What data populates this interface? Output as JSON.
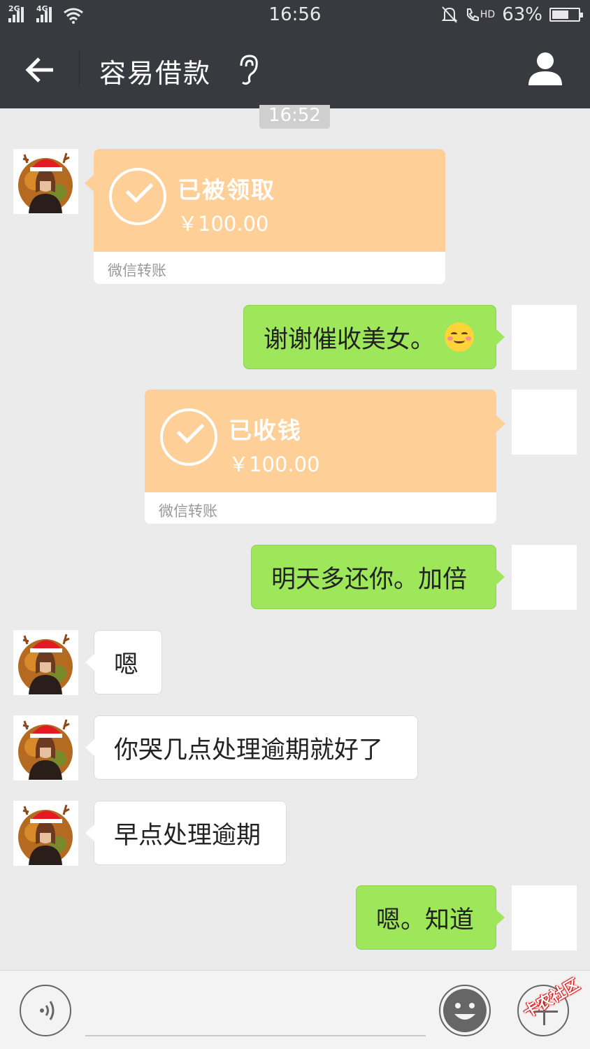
{
  "status_bar": {
    "network_1": "2G",
    "network_2": "4G",
    "time": "16:56",
    "hd_label": "HD",
    "battery_percent": "63%",
    "battery_level": 0.63
  },
  "header": {
    "title": "容易借款"
  },
  "chat": {
    "timestamp": "16:52",
    "transfer_received": {
      "status": "已被领取",
      "amount": "￥100.00",
      "footer": "微信转账"
    },
    "msg_thanks": "谢谢催收美女。",
    "transfer_collected": {
      "status": "已收钱",
      "amount": "￥100.00",
      "footer": "微信转账"
    },
    "msg_tomorrow": "明天多还你。加倍",
    "msg_en": "嗯",
    "msg_cry": "你哭几点处理逾期就好了",
    "msg_early": "早点处理逾期",
    "msg_know": "嗯。知道"
  },
  "watermark": "卡农社区",
  "colors": {
    "titlebar": "#393a3f",
    "background": "#ebebeb",
    "green_bubble": "#9ee75a",
    "transfer": "#ffcf98"
  }
}
